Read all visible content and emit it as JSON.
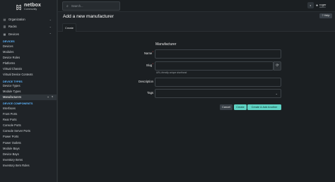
{
  "brand": {
    "name": "netbox",
    "sub": "Community"
  },
  "nav": {
    "groups": [
      {
        "label": "Organization",
        "icon": "building-icon"
      },
      {
        "label": "Racks",
        "icon": "rack-icon"
      },
      {
        "label": "Devices",
        "icon": "server-icon"
      }
    ],
    "sections": [
      {
        "label": "DEVICES",
        "items": [
          "Devices",
          "Modules",
          "Device Roles",
          "Platforms",
          "Virtual Chassis",
          "Virtual Device Contexts"
        ]
      },
      {
        "label": "DEVICE TYPES",
        "items": [
          "Device Types",
          "Module Types",
          "Manufacturers"
        ]
      },
      {
        "label": "DEVICE COMPONENTS",
        "items": [
          "Interfaces",
          "Front Ports",
          "Rear Ports",
          "Console Ports",
          "Console Server Ports",
          "Power Ports",
          "Power Outlets",
          "Module Bays",
          "Device Bays",
          "Inventory Items",
          "Inventory Item Roles"
        ]
      }
    ],
    "active": "Manufacturers"
  },
  "search": {
    "placeholder": "Search..."
  },
  "user": {
    "name": "roger",
    "role": "Admin"
  },
  "header": {
    "title": "Add a new manufacturer",
    "help_label": "Help",
    "tab_label": "Create"
  },
  "form": {
    "heading": "Manufacturer",
    "name_label": "Name",
    "slug_label": "Slug",
    "slug_help": "URL-friendly unique shorthand",
    "description_label": "Description",
    "tags_label": "Tags",
    "cancel_label": "Cancel",
    "create_label": "Create",
    "create_add_label": "Create & Add Another"
  },
  "colors": {
    "accent": "#5fd3c4",
    "section": "#5fb7ff",
    "background": "#1b1f22"
  }
}
